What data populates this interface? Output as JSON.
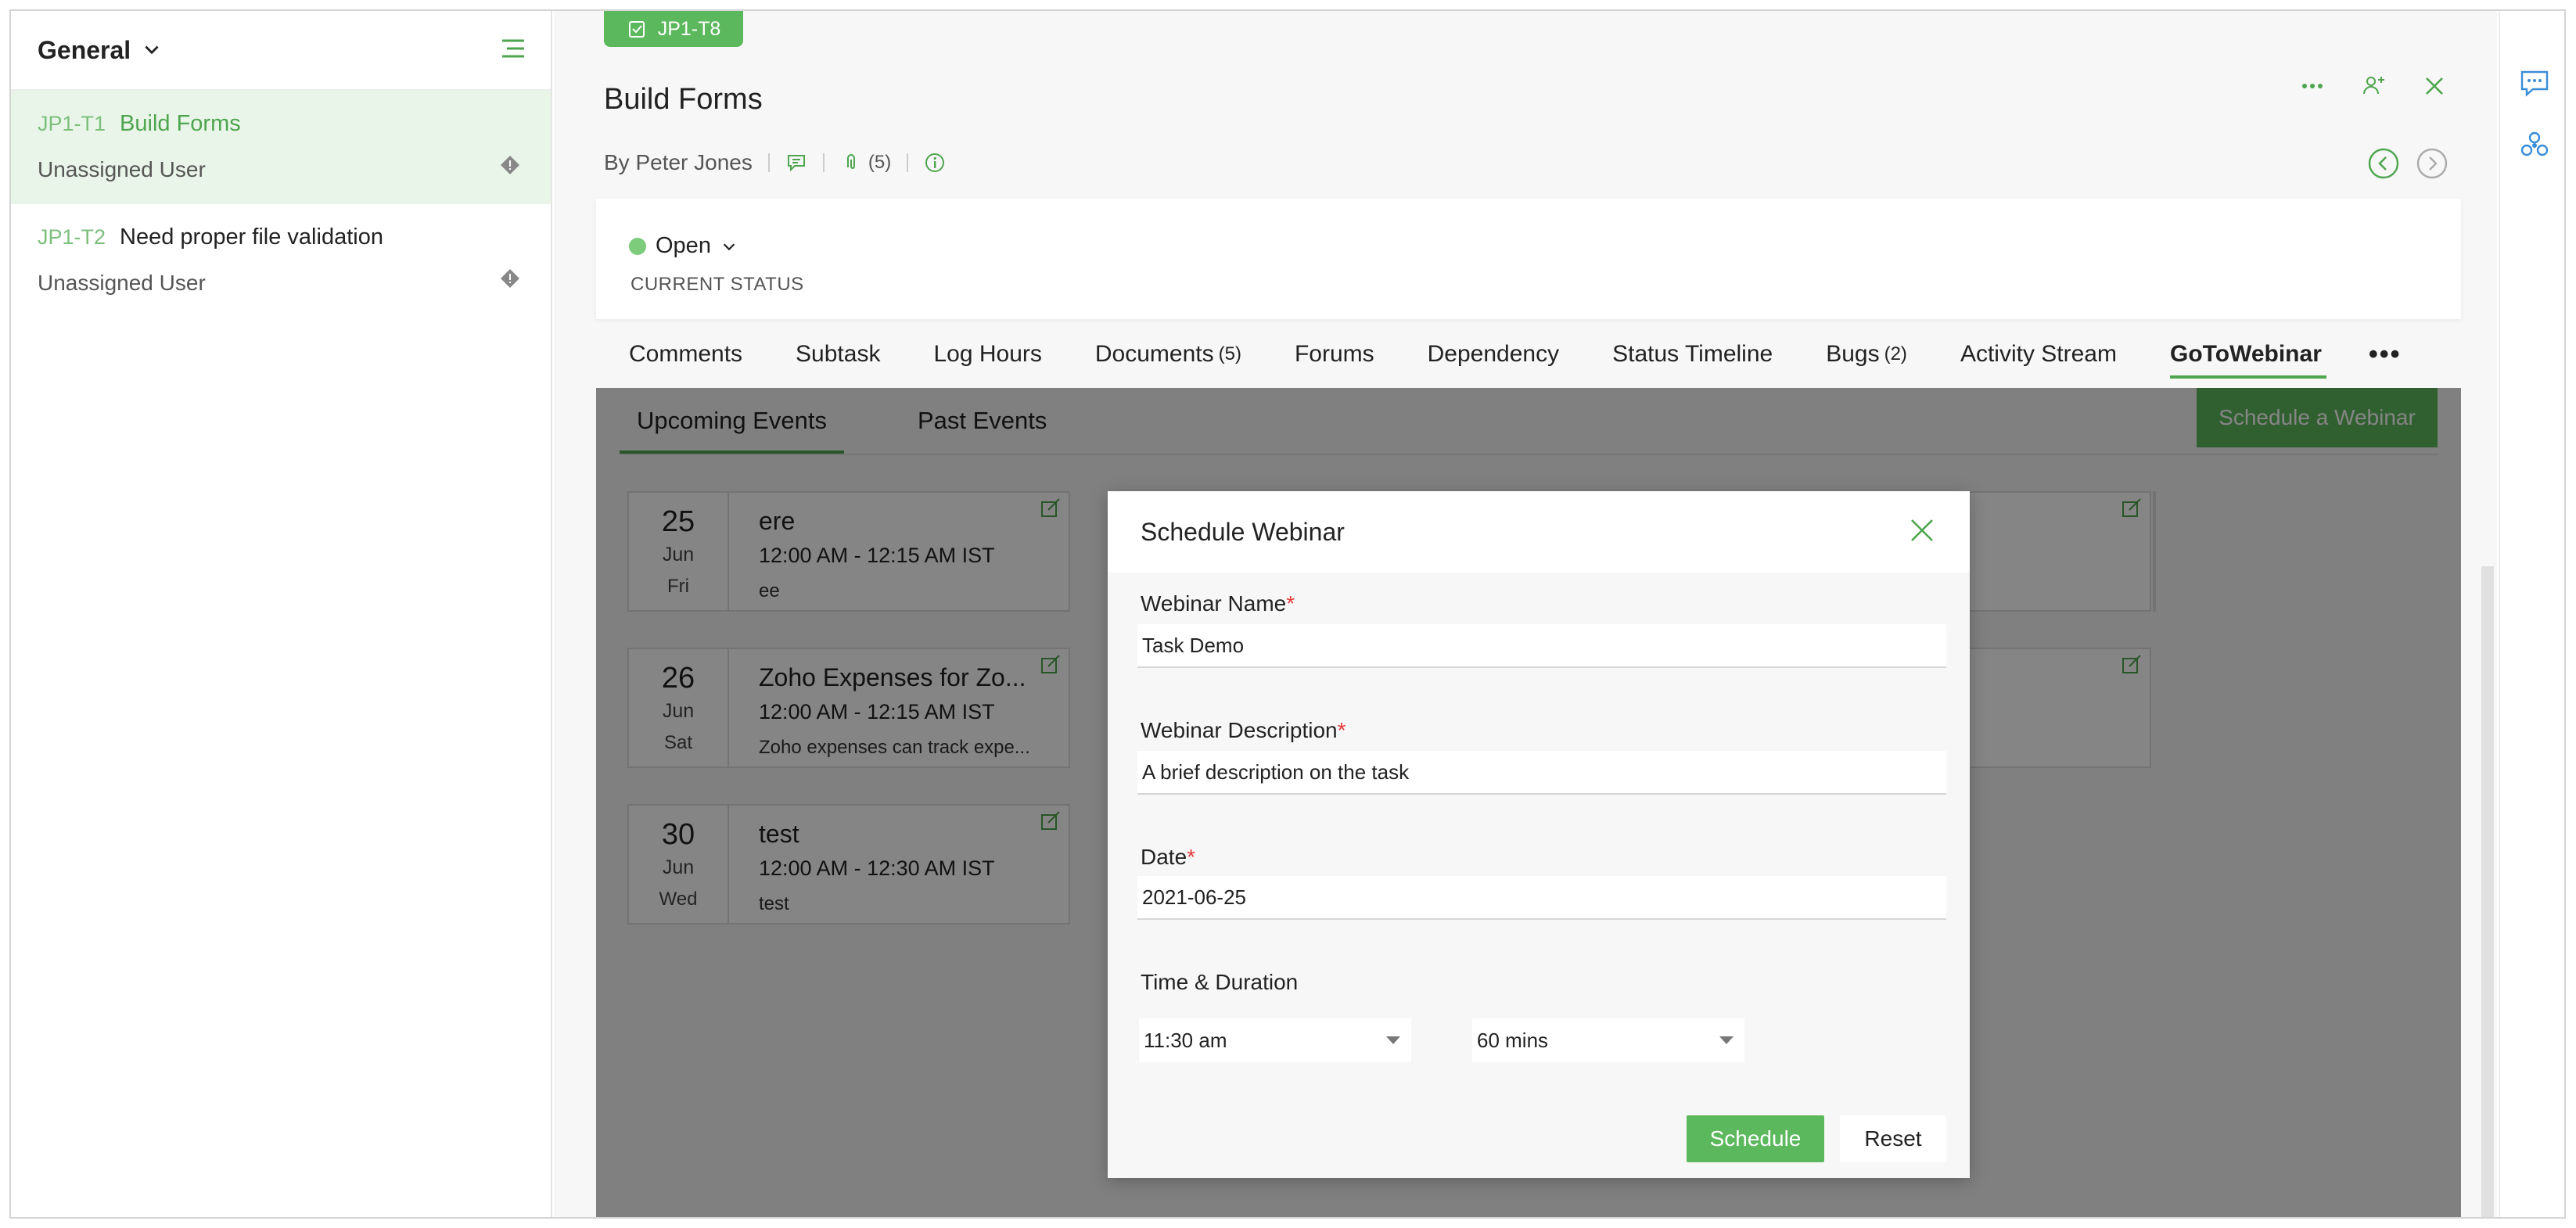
{
  "sidebar": {
    "title": "General",
    "tasks": [
      {
        "id": "JP1-T1",
        "name": "Build Forms",
        "user": "Unassigned User"
      },
      {
        "id": "JP1-T2",
        "name": "Need proper file validation",
        "user": "Unassigned User"
      }
    ]
  },
  "task": {
    "badge": "JP1-T8",
    "title": "Build Forms",
    "byline": "By Peter Jones",
    "attachments": "(5)",
    "status": "Open",
    "status_label": "CURRENT STATUS"
  },
  "tabs": [
    {
      "label": "Comments",
      "count": ""
    },
    {
      "label": "Subtask",
      "count": ""
    },
    {
      "label": "Log Hours",
      "count": ""
    },
    {
      "label": "Documents",
      "count": "(5)"
    },
    {
      "label": "Forums",
      "count": ""
    },
    {
      "label": "Dependency",
      "count": ""
    },
    {
      "label": "Status Timeline",
      "count": ""
    },
    {
      "label": "Bugs",
      "count": "(2)"
    },
    {
      "label": "Activity Stream",
      "count": ""
    },
    {
      "label": "GoToWebinar",
      "count": ""
    }
  ],
  "tab_more": "•••",
  "subtabs": [
    "Upcoming Events",
    "Past Events"
  ],
  "schedule_button": "Schedule a Webinar",
  "events": [
    {
      "day": "25",
      "month": "Jun",
      "weekday": "Fri",
      "title": "ere",
      "time": "12:00 AM - 12:15 AM IST",
      "desc": "ee"
    },
    {
      "day": "26",
      "month": "Jun",
      "weekday": "Sat",
      "title": "Zoho Expenses for Zo...",
      "time": "12:00 AM - 12:15 AM IST",
      "desc": "Zoho expenses can track expe..."
    },
    {
      "day": "30",
      "month": "Jun",
      "weekday": "Wed",
      "title": "test",
      "time": "12:00 AM - 12:30 AM IST",
      "desc": "test"
    }
  ],
  "modal": {
    "title": "Schedule Webinar",
    "name_label": "Webinar Name",
    "name_value": "Task Demo",
    "desc_label": "Webinar Description",
    "desc_value": "A brief description on the task",
    "date_label": "Date",
    "date_value": "2021-06-25",
    "time_label": "Time & Duration",
    "time_value": "11:30 am",
    "duration_value": "60 mins",
    "required_mark": "*",
    "schedule_label": "Schedule",
    "reset_label": "Reset"
  },
  "colors": {
    "accent": "#5cb85c",
    "required": "#e03b3b"
  }
}
